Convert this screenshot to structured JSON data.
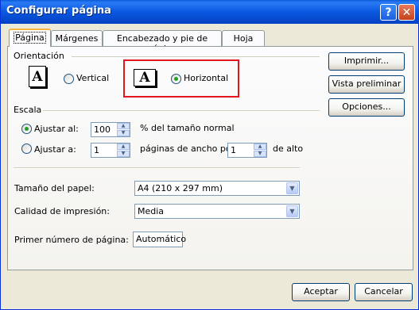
{
  "window": {
    "title": "Configurar página",
    "help_label": "?",
    "close_label": "✕"
  },
  "tabs": [
    {
      "label": "Página",
      "active": true
    },
    {
      "label": "Márgenes",
      "active": false
    },
    {
      "label": "Encabezado y pie de página",
      "active": false
    },
    {
      "label": "Hoja",
      "active": false
    }
  ],
  "orientation": {
    "label": "Orientación",
    "vertical_label": "Vertical",
    "horizontal_label": "Horizontal",
    "vertical_icon": "A",
    "horizontal_icon": "A",
    "selected": "Horizontal"
  },
  "scale": {
    "label": "Escala",
    "adjust_label": "Ajustar al:",
    "adjust_value": "100",
    "adjust_suffix": "% del tamaño normal",
    "fit_label": "Ajustar a:",
    "fit_wide_value": "1",
    "fit_wide_suffix": "páginas de ancho por",
    "fit_tall_value": "1",
    "fit_tall_suffix": "de alto",
    "selected": "Ajustar al:"
  },
  "paper": {
    "size_label": "Tamaño del papel:",
    "size_value": "A4 (210 x 297 mm)",
    "quality_label": "Calidad de impresión:",
    "quality_value": "Media",
    "first_page_label": "Primer número de página:",
    "first_page_value": "Automático"
  },
  "side_buttons": {
    "print": "Imprimir...",
    "preview": "Vista preliminar",
    "options": "Opciones..."
  },
  "footer": {
    "ok": "Aceptar",
    "cancel": "Cancelar"
  },
  "colors": {
    "title_bar": "#0a5bd8",
    "highlight_box": "#e0181e",
    "radio_dot": "#21a121"
  }
}
